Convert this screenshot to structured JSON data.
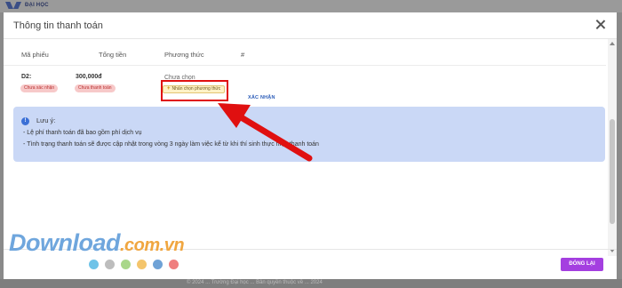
{
  "background": {
    "logo_text": "ĐẠI HỌC",
    "footer_text": "© 2024 ...  Trường Đại học ...  Bản quyền thuộc về ...  2024"
  },
  "modal": {
    "title": "Thông tin thanh toán",
    "close_icon": "close-icon"
  },
  "table": {
    "headers": [
      "Mã phiếu",
      "Tổng tiền",
      "Phương thức",
      "#"
    ],
    "rows": [
      {
        "code": "D2:",
        "code_status": "Chưa xác nhận",
        "amount": "300,000đ",
        "payment_status": "Chưa thanh toán",
        "method": "Chưa chọn",
        "method_button": "Nhấn chọn phương thức",
        "action": "XÁC NHẬN"
      }
    ]
  },
  "notice": {
    "icon": "info-icon",
    "title": "Lưu ý:",
    "lines": [
      "- Lệ phí thanh toán đã bao gồm phí dịch vụ",
      "- Tình trạng thanh toán sẽ được cập nhật trong vòng 3 ngày làm việc kể từ khi thí sinh thực hiện thanh toán"
    ]
  },
  "footer": {
    "close_button": "ĐÓNG LẠI"
  },
  "watermark": {
    "text_main": "Download",
    "text_domain": ".com.vn",
    "dot_colors": [
      "#6fc3e8",
      "#bdbdbd",
      "#a9d78a",
      "#f4c56c",
      "#6fa2d6",
      "#ef7f7f"
    ]
  },
  "colors": {
    "accent": "#a43fe0",
    "highlight": "#e01010",
    "notice_bg": "#cad8f6",
    "badge_bg": "#f7c9c9"
  }
}
